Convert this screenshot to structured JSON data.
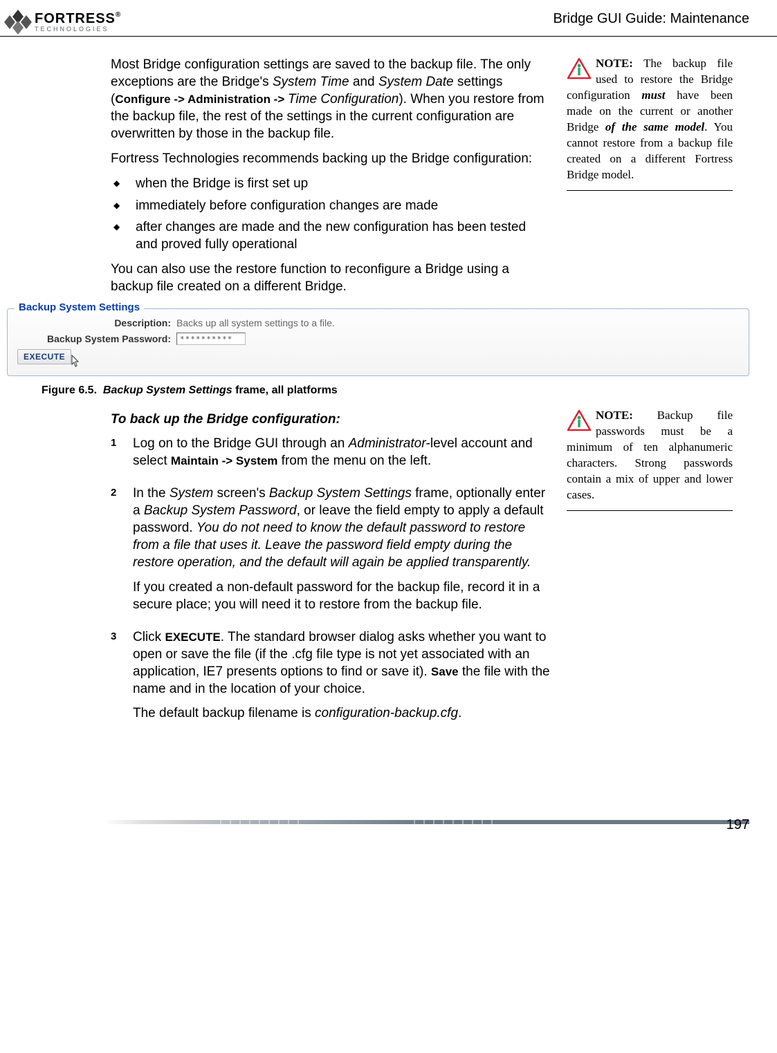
{
  "header": {
    "brand_main": "FORTRESS",
    "brand_sub": "TECHNOLOGIES",
    "doc_title": "Bridge GUI Guide: Maintenance"
  },
  "intro": {
    "p1_a": "Most Bridge configuration settings are saved to the backup file. The only exceptions are the Bridge's ",
    "p1_systime": "System Time",
    "p1_b": " and ",
    "p1_sysdate": "System Date",
    "p1_c": " settings (",
    "p1_path": "Configure -> Administration -> ",
    "p1_timecfg": "Time Configuration",
    "p1_d": "). When you restore from the backup file, the rest of the settings in the current configuration are overwritten by those in the backup file.",
    "p2": "Fortress Technologies recommends backing up the Bridge configuration:",
    "bul1": "when the Bridge is first set up",
    "bul2": "immediately before configuration changes are made",
    "bul3": "after changes are made and the new configuration has been tested and proved fully operational",
    "p3": "You can also use the restore function to reconfigure a Bridge using a backup file created on a different Bridge."
  },
  "note1": {
    "label": "NOTE:",
    "t1": " The backup file used to restore the Bridge configuration ",
    "must": "must",
    "t2": " have been made on the current or another Bridge ",
    "same": "of the same model",
    "t3": ". You cannot restore from a backup file created on a different Fortress Bridge model."
  },
  "screenshot": {
    "legend": "Backup System Settings",
    "desc_label": "Description:",
    "desc_value": "Backs up all system settings to a file.",
    "pwd_label": "Backup System Password:",
    "pwd_value": "**********",
    "execute": "EXECUTE"
  },
  "figcap": {
    "num": "Figure 6.5.",
    "ital": "Backup System Settings",
    "rest": " frame, all platforms"
  },
  "proc": {
    "heading": "To back up the Bridge configuration:",
    "s1_a": "Log on to the Bridge GUI through an ",
    "s1_admin": "Administrator",
    "s1_b": "-level account and select ",
    "s1_path": "Maintain -> System",
    "s1_c": " from the menu on the left.",
    "s2_a": "In the ",
    "s2_sys": "System",
    "s2_b": " screen's ",
    "s2_bss": "Backup System Settings",
    "s2_c": " frame, optionally enter a ",
    "s2_bsp": "Backup System Password",
    "s2_d": ", or leave the field empty to apply a default password. ",
    "s2_e": "You do not need to know the default password to restore from a file that uses it. Leave the password field empty during the restore operation, and the default will again be applied transparently.",
    "s2_f": "If you created a non-default password for the backup file, record it in a secure place; you will need it to restore from the backup file.",
    "s3_a": "Click ",
    "s3_exec": "EXECUTE",
    "s3_b": ". The standard browser dialog asks whether you want to open or save the file (if the .cfg file type is not yet associated with an application, IE7 presents options to find or save it). ",
    "s3_save": "Save",
    "s3_c": " the file with the name and in the location of your choice.",
    "s3_d": "The default backup filename is ",
    "s3_fname": "configuration-backup.cfg",
    "s3_e": "."
  },
  "note2": {
    "label": "NOTE:",
    "text": " Backup file passwords must be a minimum of ten alphanumeric characters. Strong passwords contain a mix of upper and lower cases."
  },
  "page_number": "197"
}
